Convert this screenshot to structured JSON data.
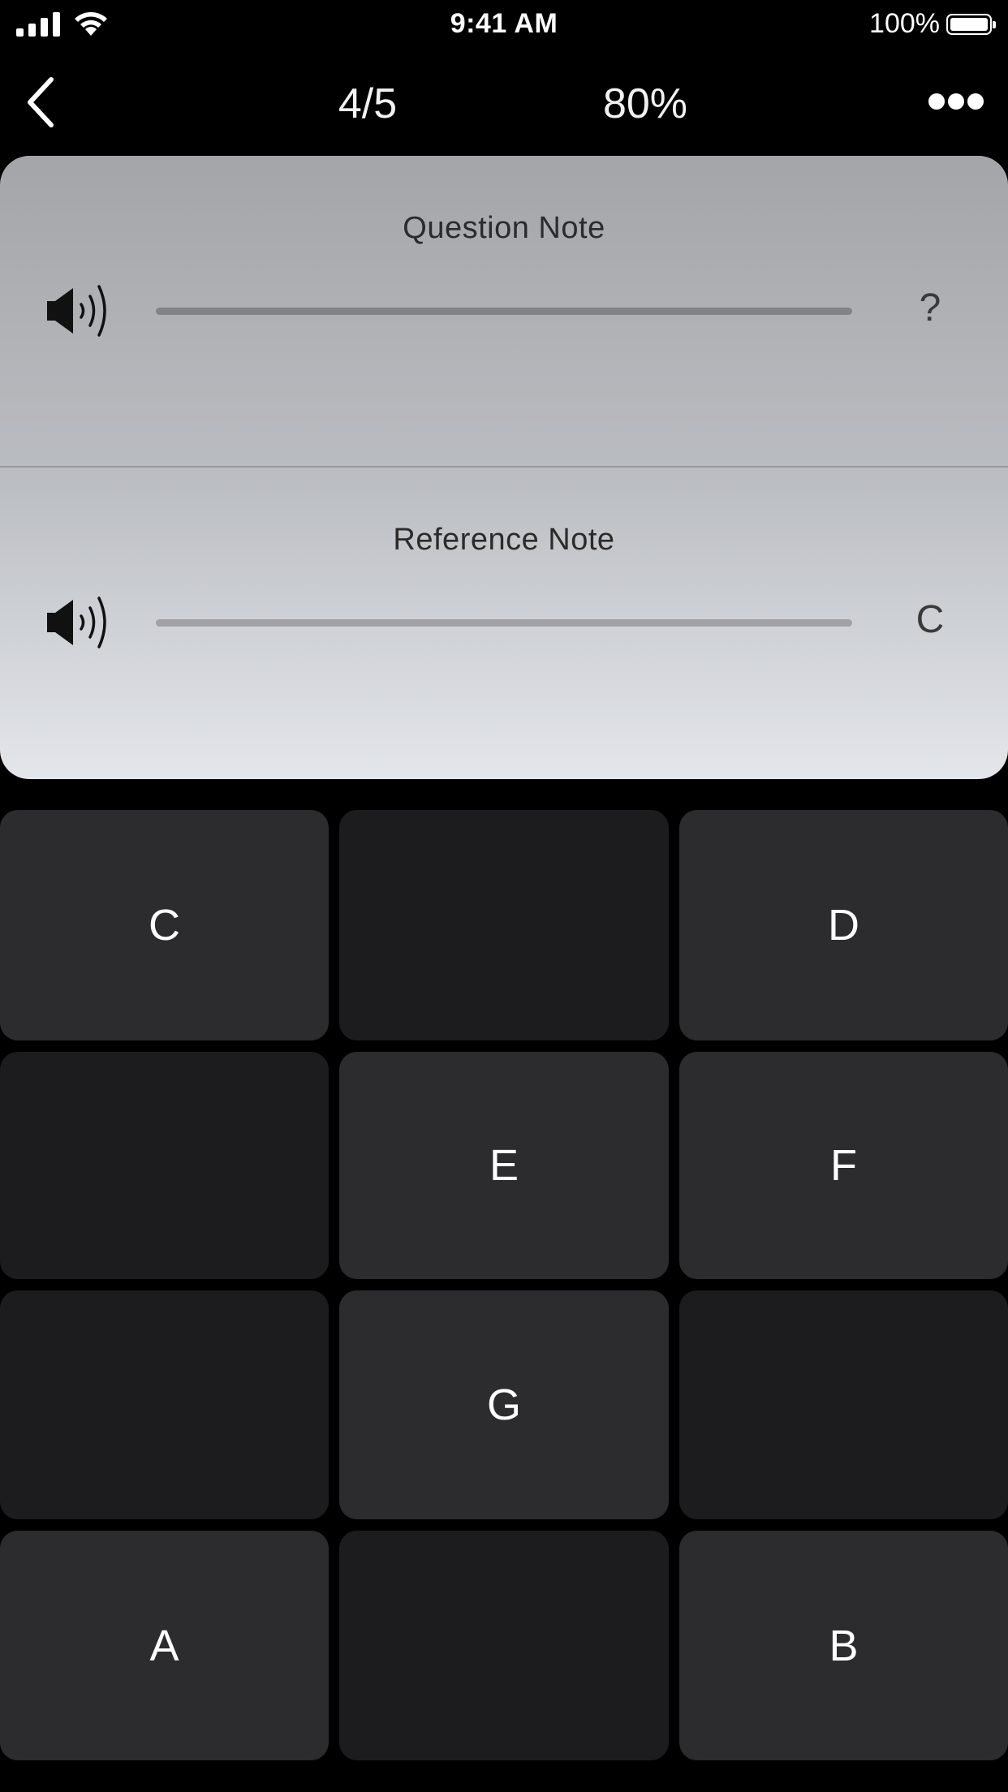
{
  "status_bar": {
    "time": "9:41 AM",
    "battery_text": "100%",
    "signal_icon": "cellular-signal-icon",
    "wifi_icon": "wifi-icon",
    "battery_icon": "battery-icon"
  },
  "nav": {
    "back_icon": "chevron-left-icon",
    "progress": "4/5",
    "score": "80%",
    "more_icon": "ellipsis-icon"
  },
  "question": {
    "title": "Question Note",
    "value": "?",
    "speaker_icon": "speaker-icon"
  },
  "reference": {
    "title": "Reference Note",
    "value": "C",
    "speaker_icon": "speaker-icon"
  },
  "keys": {
    "k0": "C",
    "k1": "",
    "k2": "D",
    "k3": "",
    "k4": "E",
    "k5": "F",
    "k6": "",
    "k7": "G",
    "k8": "",
    "k9": "A",
    "k10": "",
    "k11": "B"
  },
  "colors": {
    "background": "#000000",
    "key_active": "#2c2c2e",
    "key_blank": "#1c1c1e",
    "card_top": "#a4a5a9",
    "card_bottom": "#e3e6ea"
  }
}
